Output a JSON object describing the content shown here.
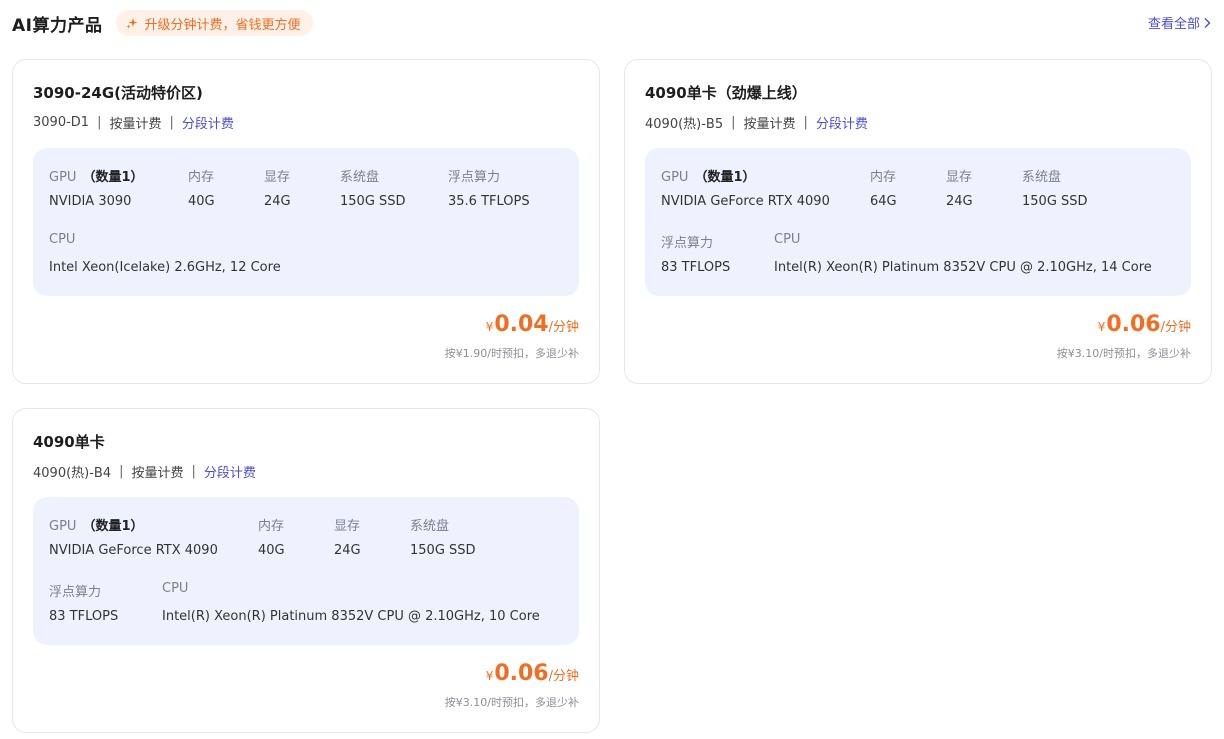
{
  "header": {
    "title": "AI算力产品",
    "promo": "升级分钟计费，省钱更方便",
    "view_all": "查看全部"
  },
  "labels": {
    "sep": "|",
    "billing": "按量计费",
    "segment": "分段计费",
    "gpu": "GPU",
    "qty": "（数量1）",
    "mem": "内存",
    "vram": "显存",
    "disk": "系统盘",
    "flops": "浮点算力",
    "cpu": "CPU",
    "currency": "¥",
    "per_min": "/分钟"
  },
  "colors": {
    "accent": "#4a4fd1",
    "price": "#f26d21",
    "spec_bg": "#eef2fe",
    "promo_bg": "#fff1e8"
  },
  "products": [
    {
      "name": "3090-24G(活动特价区)",
      "code": "3090-D1",
      "gpu": "NVIDIA 3090",
      "mem": "40G",
      "vram": "24G",
      "disk": "150G SSD",
      "flops": "35.6 TFLOPS",
      "cpu": "Intel Xeon(Icelake) 2.6GHz, 12 Core",
      "price": "0.04",
      "note": "按¥1.90/时预扣，多退少补"
    },
    {
      "name": "4090单卡（劲爆上线）",
      "code": "4090(热)-B5",
      "gpu": "NVIDIA GeForce RTX 4090",
      "mem": "64G",
      "vram": "24G",
      "disk": "150G SSD",
      "flops": "83 TFLOPS",
      "cpu": "Intel(R) Xeon(R) Platinum 8352V CPU @ 2.10GHz, 14 Core",
      "price": "0.06",
      "note": "按¥3.10/时预扣，多退少补"
    },
    {
      "name": "4090单卡",
      "code": "4090(热)-B4",
      "gpu": "NVIDIA GeForce RTX 4090",
      "mem": "40G",
      "vram": "24G",
      "disk": "150G SSD",
      "flops": "83 TFLOPS",
      "cpu": "Intel(R) Xeon(R) Platinum 8352V CPU @ 2.10GHz, 10 Core",
      "price": "0.06",
      "note": "按¥3.10/时预扣，多退少补"
    }
  ]
}
